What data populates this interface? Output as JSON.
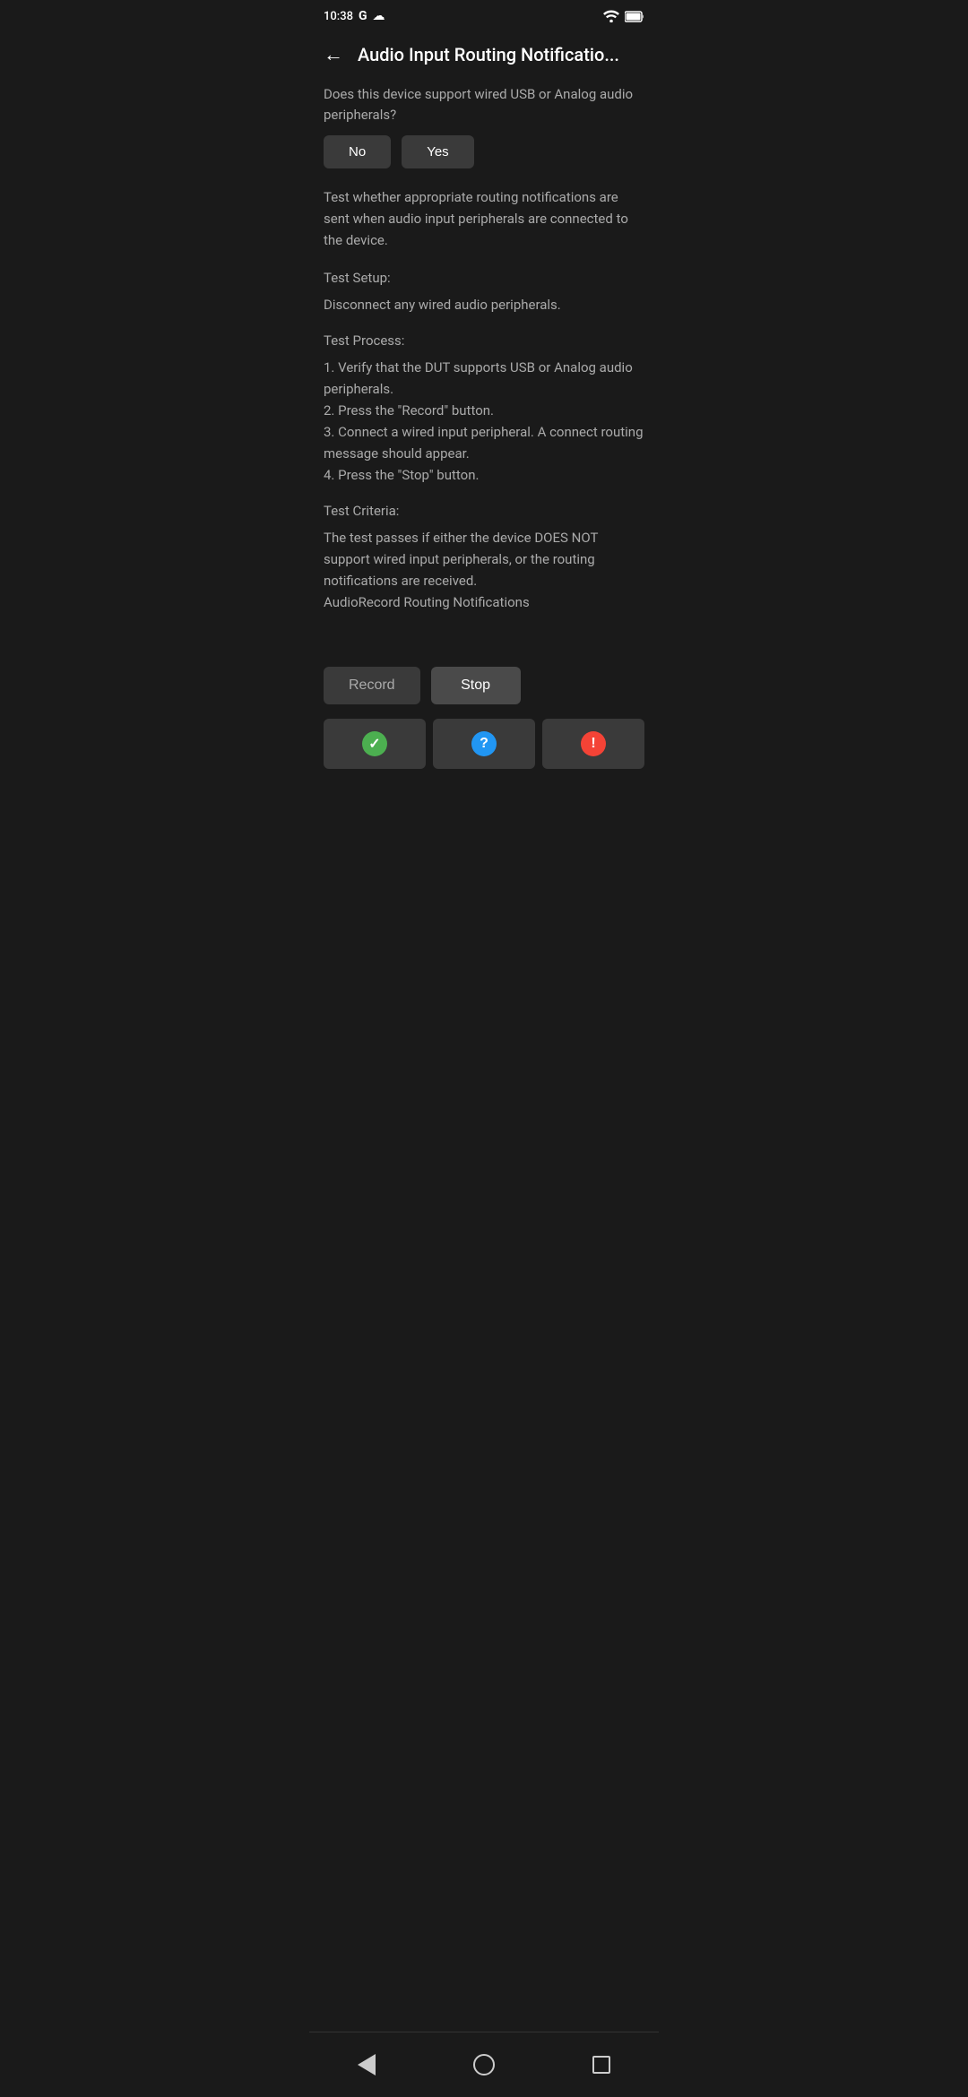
{
  "statusBar": {
    "time": "10:38",
    "googleIcon": "G",
    "cloudIcon": "☁"
  },
  "header": {
    "backLabel": "←",
    "title": "Audio Input Routing Notificatio..."
  },
  "content": {
    "questionText": "Does this device support wired USB or Analog audio peripherals?",
    "noLabel": "No",
    "yesLabel": "Yes",
    "descriptionText": "Test whether appropriate routing notifications are sent when audio input peripherals are connected to the device.",
    "setupTitle": "Test Setup:",
    "setupBody": "Disconnect any wired audio peripherals.",
    "processTitle": "Test Process:",
    "processBody": "1. Verify that the DUT supports USB or Analog audio peripherals.\n2. Press the \"Record\" button.\n3. Connect a wired input peripheral. A connect routing message should appear.\n4. Press the \"Stop\" button.",
    "criteriaTitle": "Test Criteria:",
    "criteriaBody": "The test passes if either the device DOES NOT support wired input peripherals, or the routing notifications are received.\nAudioRecord Routing Notifications"
  },
  "actions": {
    "recordLabel": "Record",
    "stopLabel": "Stop"
  },
  "results": {
    "passIcon": "✓",
    "questionIcon": "?",
    "failIcon": "!"
  }
}
